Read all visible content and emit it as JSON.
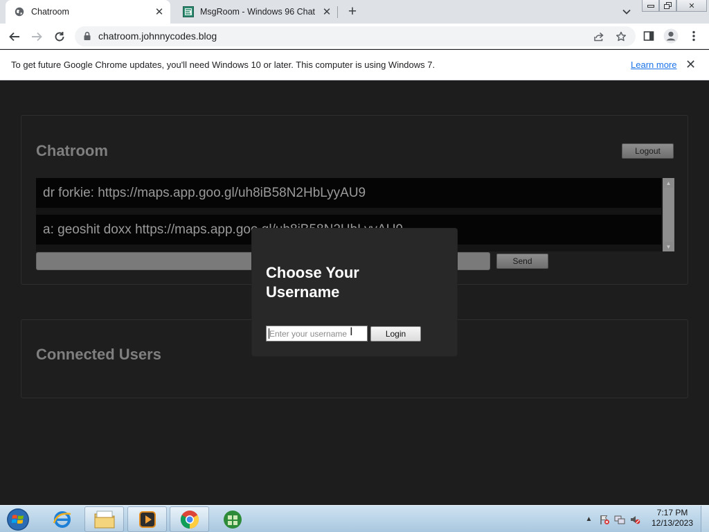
{
  "browser": {
    "tabs": [
      {
        "label": "Chatroom",
        "favicon": "globe-icon",
        "active": true,
        "close": "✕"
      },
      {
        "label": "MsgRoom - Windows 96 Chat",
        "favicon": "msgroom-icon",
        "active": false,
        "close": "✕"
      }
    ],
    "new_tab": "+",
    "window_controls": {
      "minimize": "▭",
      "restore": "❐",
      "close": "✕"
    },
    "url": "chatroom.johnnycodes.blog"
  },
  "infobar": {
    "message": "To get future Google Chrome updates, you'll need Windows 10 or later. This computer is using Windows 7.",
    "link": "Learn more",
    "close": "✕"
  },
  "chatroom": {
    "title": "Chatroom",
    "logout_label": "Logout",
    "messages": [
      "dr forkie: https://maps.app.goo.gl/uh8iB58N2HbLyyAU9",
      "a: geoshit doxx https://maps.app.goo.gl/uh8iB58N2HbLyyAU9"
    ],
    "input_value": "",
    "send_label": "Send"
  },
  "users_panel": {
    "title": "Connected Users"
  },
  "modal": {
    "title": "Choose Your Username",
    "placeholder": "Enter your username",
    "login_label": "Login"
  },
  "taskbar": {
    "time": "7:17 PM",
    "date": "12/13/2023",
    "items": [
      "internet-explorer-icon",
      "file-explorer-icon",
      "media-player-icon",
      "chrome-icon",
      "windows-update-icon"
    ]
  },
  "colors": {
    "page_bg": "#1d1d1d",
    "card_border": "#2f2f2f",
    "modal_bg": "#282828",
    "message_row": "#050505",
    "link_blue": "#1a73e8"
  }
}
